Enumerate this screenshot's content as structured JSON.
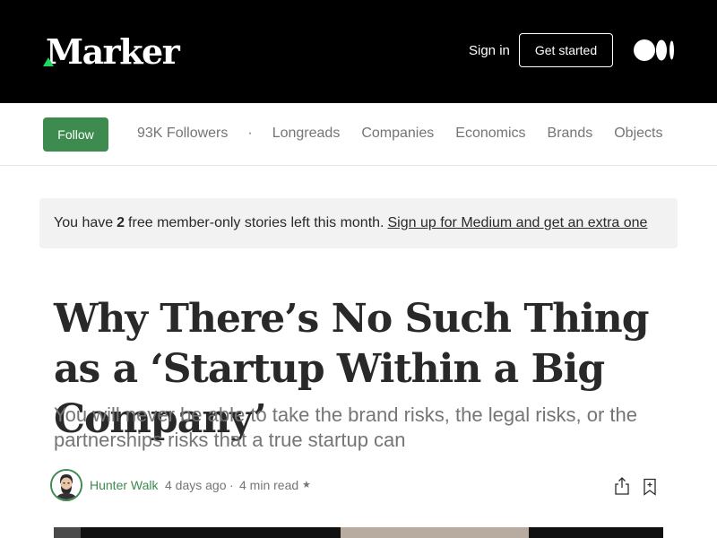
{
  "header": {
    "logo_text": "Marker",
    "sign_in": "Sign in",
    "get_started": "Get started",
    "medium_logo_icon": "medium-logo-icon",
    "accent_color": "#1ed760"
  },
  "nav": {
    "follow": "Follow",
    "followers": "93K Followers",
    "dot": "·",
    "links": [
      "Longreads",
      "Companies",
      "Economics",
      "Brands",
      "Objects"
    ],
    "follow_color": "#3d8b4e"
  },
  "banner": {
    "prefix": "You have",
    "count": "2",
    "suffix": "free member-only stories left this month.",
    "link": "Sign up for Medium and get an extra one"
  },
  "article": {
    "title": "Why There’s No Such Thing as a ‘Startup Within a Big Company’",
    "subtitle": "You will never be able to take the brand risks, the legal risks, or the partnerships risks that a true startup can",
    "author": "Hunter Walk",
    "date": "4 days ago",
    "separator": "·",
    "read_time": "4 min read",
    "star": "★",
    "share_icon": "share-icon",
    "bookmark_icon": "bookmark-icon"
  }
}
